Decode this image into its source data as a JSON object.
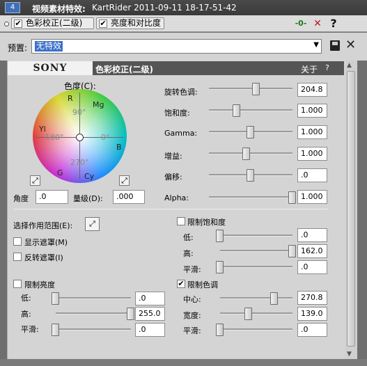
{
  "titlebar": {
    "num": "4",
    "label": "视频素材特效:",
    "value": "KartRider 2011-09-11 18-17-51-42"
  },
  "chain": [
    {
      "label": "色彩校正(二级)",
      "checked": "✔"
    },
    {
      "label": "亮度和对比度",
      "checked": "✔"
    }
  ],
  "toolbar": {
    "plugin_chain_icon": "-0-",
    "remove_icon": "✕",
    "help_icon": "?"
  },
  "preset": {
    "label": "预置:",
    "value": "无特效",
    "dropdown": "▼",
    "save_icon": "save-icon",
    "delete_icon": "✕"
  },
  "panel": {
    "logo": "SONY",
    "title": "色彩校正(二级)",
    "about": "关于",
    "help": "?"
  },
  "wheel": {
    "title": "色度(C):",
    "labels": {
      "R": "R",
      "Mg": "Mg",
      "Yl": "Yl",
      "B": "B",
      "G": "G",
      "Cy": "Cy"
    },
    "degrees": {
      "d90": "90°",
      "d180": "180°",
      "d0": "0°",
      "d270": "270°"
    },
    "angle_label": "角度",
    "angle_value": ".0",
    "magnitude_label": "量级(D):",
    "magnitude_value": ".000"
  },
  "adjust": [
    {
      "label": "旋转色调:",
      "value": "204.8",
      "level": 0.57
    },
    {
      "label": "饱和度:",
      "value": "1.000",
      "level": 0.33
    },
    {
      "label": "Gamma:",
      "value": "1.000",
      "level": 0.5
    },
    {
      "label": "增益:",
      "value": "1.000",
      "level": 0.45
    },
    {
      "label": "偏移:",
      "value": ".0",
      "level": 0.5
    },
    {
      "label": "Alpha:",
      "value": "1.000",
      "level": 1.0
    }
  ],
  "range": {
    "select_label": "选择作用范围(E):",
    "show_mask": "显示遮罩(M)",
    "invert_mask": "反转遮罩(I)"
  },
  "limit_saturation": {
    "label": "限制饱和度",
    "checked": "",
    "low_label": "低:",
    "low_value": ".0",
    "low_level": 0.0,
    "high_label": "高:",
    "high_value": "162.0",
    "high_level": 1.0,
    "smooth_label": "平滑:",
    "smooth_value": ".0",
    "smooth_level": 0.0
  },
  "limit_luma": {
    "label": "限制亮度",
    "checked": "",
    "low_label": "低:",
    "low_value": ".0",
    "low_level": 0.0,
    "high_label": "高:",
    "high_value": "255.0",
    "high_level": 1.0,
    "smooth_label": "平滑:",
    "smooth_value": ".0",
    "smooth_level": 0.0
  },
  "limit_hue": {
    "label": "限制色调",
    "checked": "✔",
    "center_label": "中心:",
    "center_value": "270.8",
    "center_level": 0.75,
    "width_label": "宽度:",
    "width_value": "139.0",
    "width_level": 0.39,
    "smooth_label": "平滑:",
    "smooth_value": ".0",
    "smooth_level": 0.0
  }
}
